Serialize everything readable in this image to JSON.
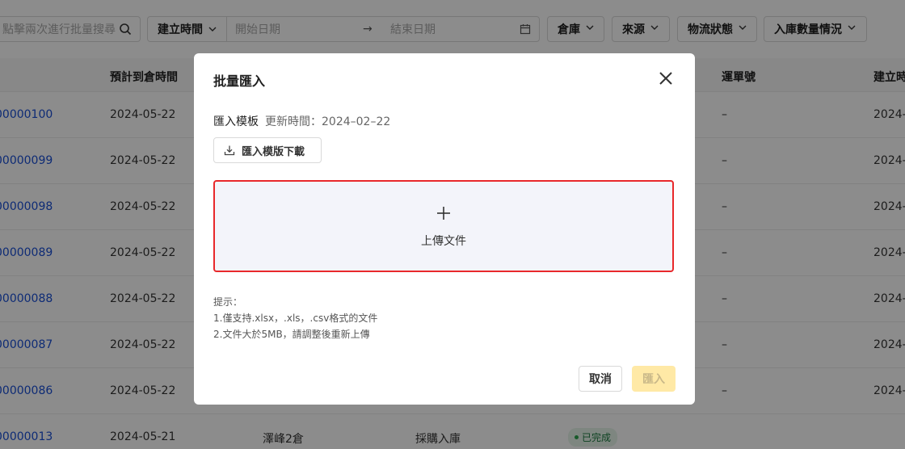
{
  "filters": {
    "search_placeholder": "點擊兩次進行批量搜尋",
    "date_type": "建立時間",
    "start_placeholder": "開始日期",
    "arrow": "→",
    "end_placeholder": "結束日期",
    "dropdowns": [
      "倉庫",
      "來源",
      "物流狀態",
      "入庫數量情況"
    ]
  },
  "table": {
    "headers": {
      "eta": "預計到倉時間",
      "tracking": "運單號",
      "created": "建立時"
    },
    "rows": [
      {
        "id": "00000100",
        "eta": "2024-05-22",
        "tracking": "–",
        "created": "2024-"
      },
      {
        "id": "00000099",
        "eta": "2024-05-22",
        "tracking": "–",
        "created": "2024-"
      },
      {
        "id": "00000098",
        "eta": "2024-05-22",
        "tracking": "–",
        "created": "2024-"
      },
      {
        "id": "00000089",
        "eta": "2024-05-22",
        "tracking": "–",
        "created": "2024-"
      },
      {
        "id": "00000088",
        "eta": "2024-05-22",
        "tracking": "–",
        "created": "2024-"
      },
      {
        "id": "00000087",
        "eta": "2024-05-22",
        "tracking": "–",
        "created": "2024-"
      },
      {
        "id": "00000086",
        "eta": "2024-05-22",
        "tracking": "–",
        "created": "2024-"
      },
      {
        "id": "00000013",
        "eta": "2024-05-21",
        "warehouse": "澤峰2倉",
        "source": "採購入庫",
        "status": "已完成",
        "tracking": "",
        "created": ""
      }
    ]
  },
  "modal": {
    "title": "批量匯入",
    "template_label": "匯入模板",
    "template_updated": "更新時間：2024–02–22",
    "download_button": "匯入模版下載",
    "upload_label": "上傳文件",
    "tips_title": "提示：",
    "tips": [
      "1.僅支持.xlsx，.xls，.csv格式的文件",
      "2.文件大於5MB，請調整後重新上傳"
    ],
    "cancel_button": "取消",
    "import_button": "匯入"
  },
  "colors": {
    "upload_border": "#e8282b",
    "link": "#1a4fd6",
    "import_disabled_bg": "#ffe9a6"
  },
  "icons": [
    "search-icon",
    "chevron-down-icon",
    "calendar-icon",
    "close-icon",
    "download-icon",
    "plus-icon"
  ]
}
